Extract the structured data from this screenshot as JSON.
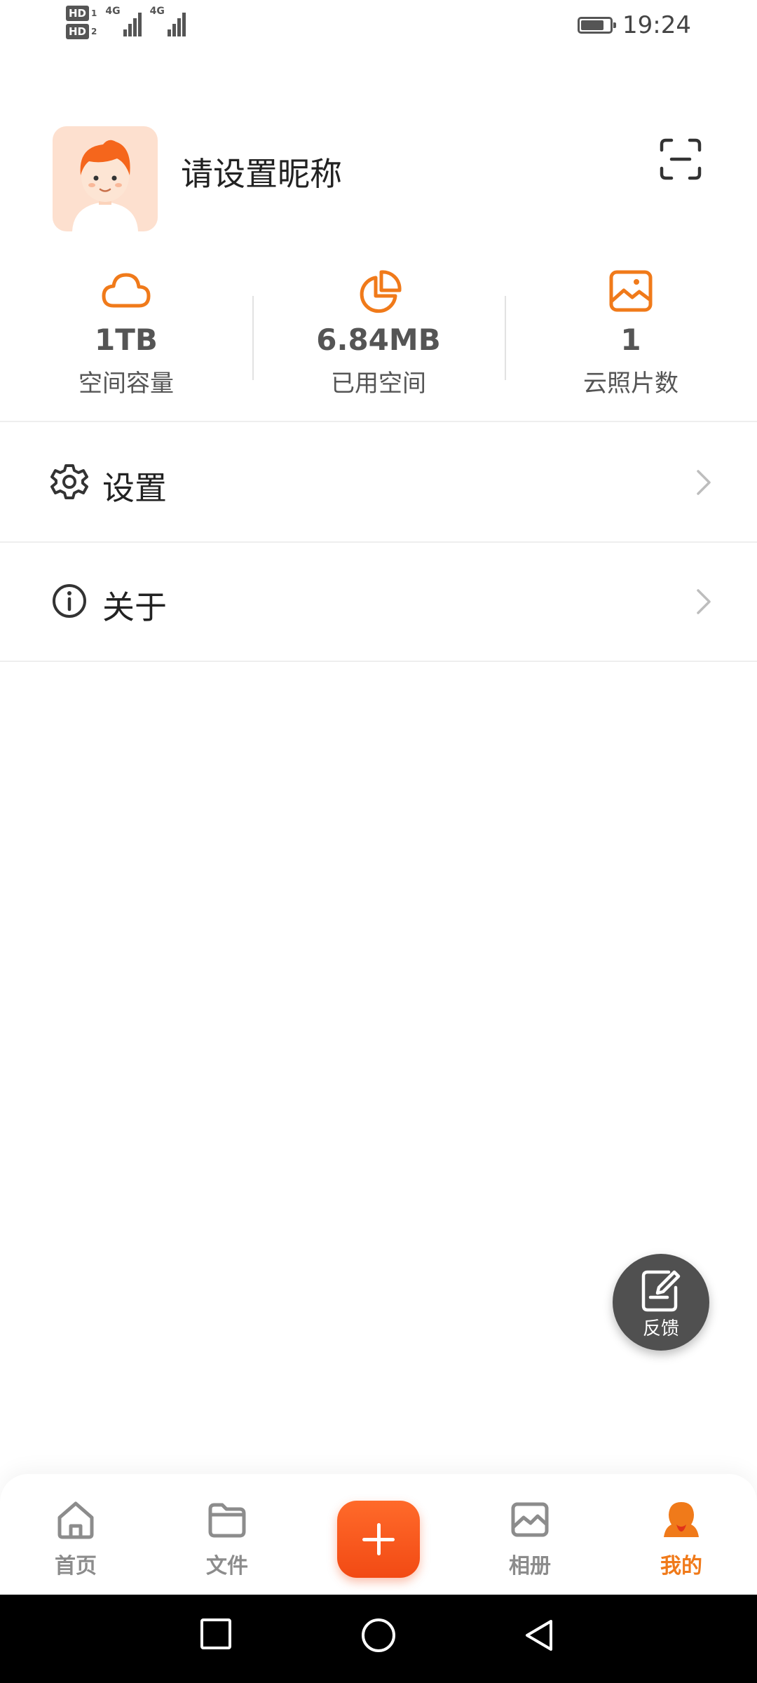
{
  "status_bar": {
    "hd_badges": [
      {
        "label": "HD",
        "sim": "1"
      },
      {
        "label": "HD",
        "sim": "2"
      }
    ],
    "networks": [
      "4G",
      "4G"
    ],
    "time": "19:24",
    "battery_level": 0.8
  },
  "profile": {
    "nickname": "请设置昵称",
    "avatar_icon": "cartoon-avatar",
    "scan_icon": "scan-icon"
  },
  "stats": [
    {
      "icon": "cloud-icon",
      "value": "1TB",
      "label": "空间容量"
    },
    {
      "icon": "pie-chart-icon",
      "value": "6.84MB",
      "label": "已用空间"
    },
    {
      "icon": "image-icon",
      "value": "1",
      "label": "云照片数"
    }
  ],
  "menu": [
    {
      "icon": "gear-icon",
      "label": "设置"
    },
    {
      "icon": "info-icon",
      "label": "关于"
    }
  ],
  "feedback": {
    "label": "反馈"
  },
  "tabs": [
    {
      "icon": "home-icon",
      "label": "首页",
      "active": false
    },
    {
      "icon": "folder-icon",
      "label": "文件",
      "active": false
    },
    {
      "icon": "add-icon",
      "label": "",
      "active": false
    },
    {
      "icon": "album-icon",
      "label": "相册",
      "active": false
    },
    {
      "icon": "user-icon",
      "label": "我的",
      "active": true
    }
  ],
  "colors": {
    "accent": "#f07a1a",
    "add_button": "#f24a14",
    "inactive_tab": "#8c8c8c",
    "fab": "#505050"
  }
}
